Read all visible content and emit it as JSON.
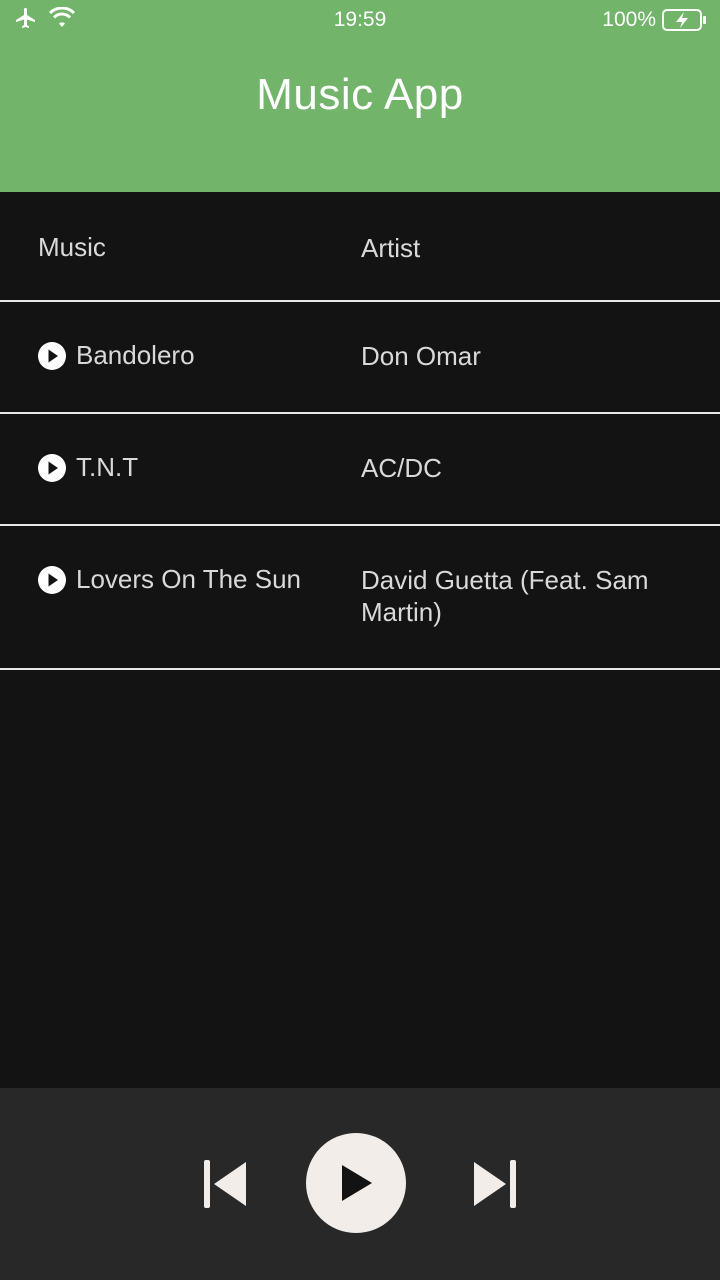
{
  "status_bar": {
    "time": "19:59",
    "battery": "100%",
    "icons": [
      "airplane-icon",
      "wifi-icon",
      "battery-charging-icon"
    ]
  },
  "app": {
    "title": "Music App",
    "header_color": "#71b46a"
  },
  "table": {
    "headers": {
      "music": "Music",
      "artist": "Artist"
    },
    "rows": [
      {
        "music": "Bandolero",
        "artist": "Don Omar"
      },
      {
        "music": "T.N.T",
        "artist": "AC/DC"
      },
      {
        "music": "Lovers On The Sun",
        "artist": "David Guetta (Feat. Sam Martin)"
      }
    ]
  },
  "player": {
    "controls": [
      "skip-previous-icon",
      "play-icon",
      "skip-next-icon"
    ]
  }
}
